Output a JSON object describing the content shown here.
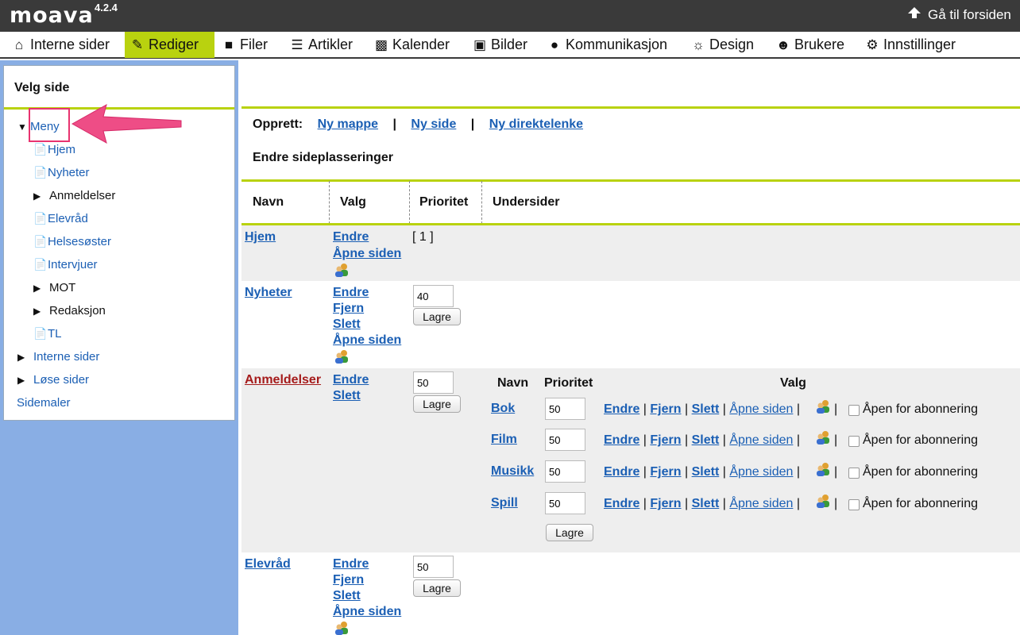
{
  "topbar": {
    "logo": "moava",
    "version": "4.2.4",
    "goto_label": "Gå til forsiden"
  },
  "menu": [
    {
      "label": "Interne sider",
      "icon": "home-icon"
    },
    {
      "label": "Rediger",
      "icon": "pencil-icon",
      "active": true
    },
    {
      "label": "Filer",
      "icon": "folder-icon"
    },
    {
      "label": "Artikler",
      "icon": "document-icon"
    },
    {
      "label": "Kalender",
      "icon": "calendar-icon"
    },
    {
      "label": "Bilder",
      "icon": "image-icon"
    },
    {
      "label": "Kommunikasjon",
      "icon": "chat-icon"
    },
    {
      "label": "Design",
      "icon": "palette-icon"
    },
    {
      "label": "Brukere",
      "icon": "users-icon"
    },
    {
      "label": "Innstillinger",
      "icon": "gears-icon"
    }
  ],
  "sidebar": {
    "title": "Velg side",
    "root": "Meny",
    "items": [
      "Hjem",
      "Nyheter",
      "Anmeldelser",
      "Elevråd",
      "Helsesøster",
      "Intervjuer",
      "MOT",
      "Redaksjon",
      "TL"
    ],
    "bottom": [
      "Interne sider",
      "Løse sider",
      "Sidemaler"
    ]
  },
  "create": {
    "label": "Opprett:",
    "links": [
      "Ny mappe",
      "Ny side",
      "Ny direktelenke"
    ]
  },
  "reorder_label": "Endre sideplasseringer",
  "table": {
    "headers": [
      "Navn",
      "Valg",
      "Prioritet",
      "Undersider"
    ],
    "rows": {
      "hjem": {
        "name": "Hjem",
        "endre": "Endre",
        "open": "Åpne siden",
        "priority": "[ 1 ]"
      },
      "nyheter": {
        "name": "Nyheter",
        "endre": "Endre",
        "fjern": "Fjern",
        "slett": "Slett",
        "open": "Åpne siden",
        "priority": "40",
        "save": "Lagre"
      },
      "anmeldelser": {
        "name": "Anmeldelser",
        "endre": "Endre",
        "slett": "Slett",
        "priority": "50",
        "save": "Lagre"
      },
      "elevrad": {
        "name": "Elevråd",
        "endre": "Endre",
        "fjern": "Fjern",
        "slett": "Slett",
        "open": "Åpne siden",
        "priority": "50",
        "save": "Lagre"
      }
    }
  },
  "subpages": {
    "headers": {
      "name": "Navn",
      "priority": "Prioritet",
      "options": "Valg"
    },
    "actions": {
      "endre": "Endre",
      "fjern": "Fjern",
      "slett": "Slett",
      "open": "Åpne siden",
      "sep": "|",
      "subscribe": "Åpen for abonnering"
    },
    "items": [
      {
        "name": "Bok",
        "priority": "50"
      },
      {
        "name": "Film",
        "priority": "50"
      },
      {
        "name": "Musikk",
        "priority": "50"
      },
      {
        "name": "Spill",
        "priority": "50"
      }
    ],
    "save": "Lagre"
  }
}
